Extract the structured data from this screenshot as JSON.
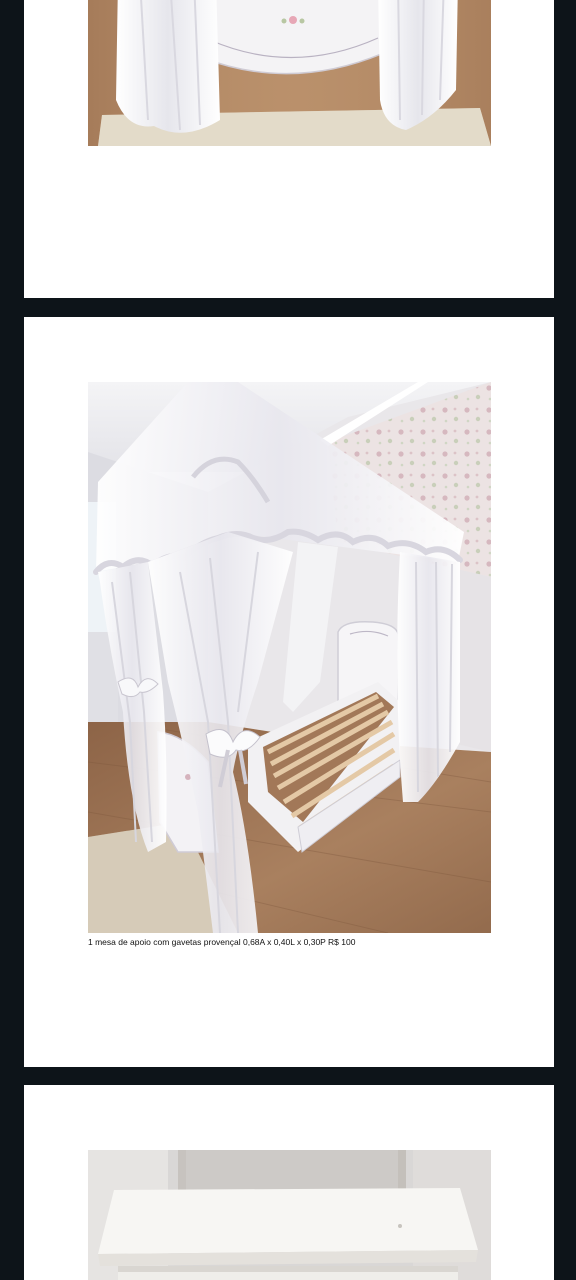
{
  "document": {
    "pages": [
      {
        "photo_subject": "canopy-bed-footboard-photo"
      },
      {
        "photo_subject": "canopy-bed-photo",
        "caption": "1 mesa de apoio com gavetas provençal 0,68A x 0,40L x 0,30P R$ 100"
      },
      {
        "photo_subject": "side-table-photo"
      }
    ]
  },
  "colors": {
    "viewer_background": "#0d1419",
    "page_background": "#ffffff",
    "floor": "#a57a58",
    "curtain": "#f1f0f2",
    "wallpaper": "#e6d9d9"
  }
}
